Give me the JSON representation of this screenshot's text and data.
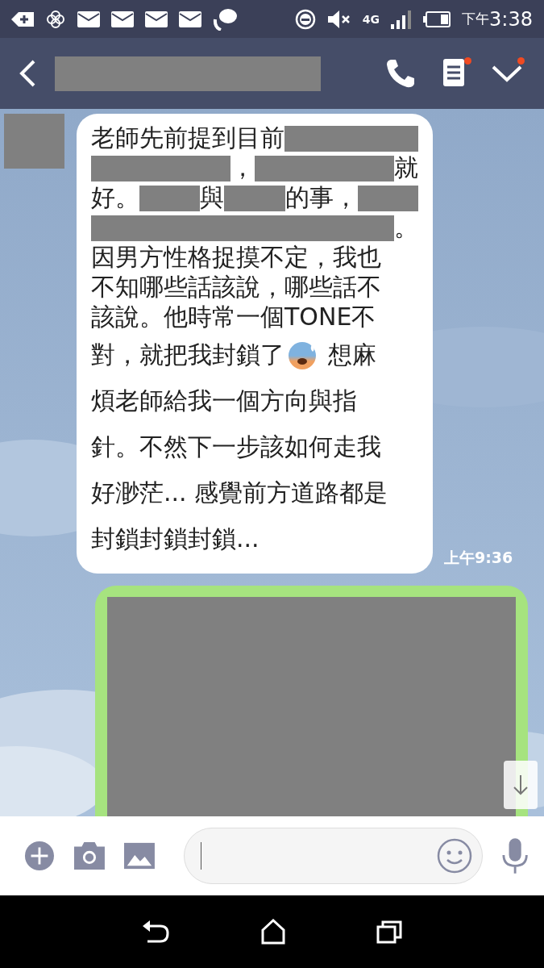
{
  "status_bar": {
    "network": "4G",
    "time_prefix": "下午",
    "time": "3:38"
  },
  "header": {
    "title": {
      "kind": "redacted"
    },
    "notes_badge": true,
    "menu_badge": true
  },
  "messages": [
    {
      "kind": "received",
      "avatar": {
        "kind": "redacted"
      },
      "time": "上午9:36",
      "lines": [
        [
          {
            "kind": "text",
            "text": "老師先前提到目前"
          },
          {
            "kind": "redacted"
          }
        ],
        [
          {
            "kind": "redacted"
          },
          {
            "kind": "text",
            "text": "，"
          },
          {
            "kind": "redacted"
          },
          {
            "kind": "text",
            "text": "就"
          }
        ],
        [
          {
            "kind": "text",
            "text": "好。"
          },
          {
            "kind": "redacted"
          },
          {
            "kind": "text",
            "text": "與"
          },
          {
            "kind": "redacted"
          },
          {
            "kind": "text",
            "text": "的事，"
          },
          {
            "kind": "redacted"
          }
        ],
        [
          {
            "kind": "redacted"
          },
          {
            "kind": "text",
            "text": "。"
          }
        ],
        [
          {
            "kind": "text",
            "text": "因男方性格捉摸不定，我也"
          }
        ],
        [
          {
            "kind": "text",
            "text": "不知哪些話該說，哪些話不"
          }
        ],
        [
          {
            "kind": "text",
            "text": "該說。他時常一個TONE不"
          }
        ],
        [
          {
            "kind": "text",
            "text": "對，就把我封鎖了"
          },
          {
            "kind": "emoji"
          },
          {
            "kind": "text",
            "text": "想麻"
          }
        ],
        [
          {
            "kind": "text",
            "text": "煩老師給我一個方向與指"
          }
        ],
        [
          {
            "kind": "text",
            "text": "針。不然下一步該如何走我"
          }
        ],
        [
          {
            "kind": "text",
            "text": "好渺茫... 感覺前方道路都是"
          }
        ],
        [
          {
            "kind": "text",
            "text": "封鎖封鎖封鎖..."
          }
        ]
      ]
    },
    {
      "kind": "sent",
      "content": {
        "kind": "redacted"
      }
    }
  ]
}
